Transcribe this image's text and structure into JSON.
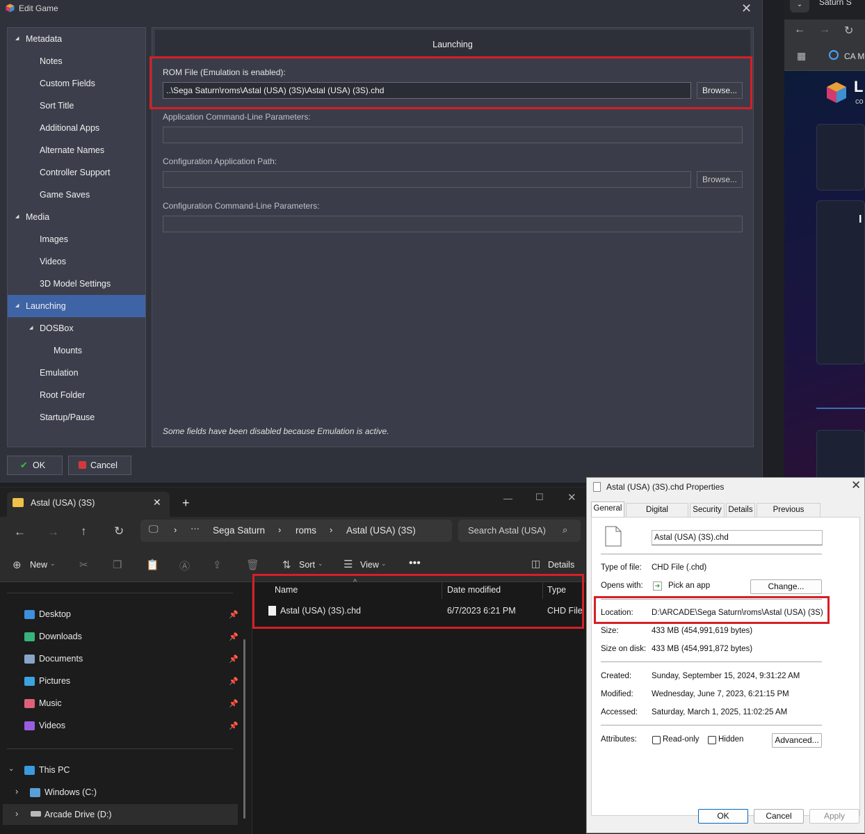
{
  "edit_game": {
    "title": "Edit Game",
    "sidebar": [
      {
        "label": "Metadata",
        "level": 0,
        "expanded": true
      },
      {
        "label": "Notes",
        "level": 1
      },
      {
        "label": "Custom Fields",
        "level": 1
      },
      {
        "label": "Sort Title",
        "level": 1
      },
      {
        "label": "Additional Apps",
        "level": 1
      },
      {
        "label": "Alternate Names",
        "level": 1
      },
      {
        "label": "Controller Support",
        "level": 1
      },
      {
        "label": "Game Saves",
        "level": 1
      },
      {
        "label": "Media",
        "level": 0,
        "expanded": true
      },
      {
        "label": "Images",
        "level": 1
      },
      {
        "label": "Videos",
        "level": 1
      },
      {
        "label": "3D Model Settings",
        "level": 1
      },
      {
        "label": "Launching",
        "level": 0,
        "expanded": true,
        "selected": true
      },
      {
        "label": "DOSBox",
        "level": 1,
        "expanded": true
      },
      {
        "label": "Mounts",
        "level": 2
      },
      {
        "label": "Emulation",
        "level": 1
      },
      {
        "label": "Root Folder",
        "level": 1
      },
      {
        "label": "Startup/Pause",
        "level": 1
      }
    ],
    "panel_title": "Launching",
    "rom_label": "ROM File (Emulation is enabled):",
    "rom_value": "..\\Sega  Saturn\\roms\\Astal (USA) (3S)\\Astal (USA) (3S).chd",
    "browse_label": "Browse...",
    "app_params_label": "Application Command-Line Parameters:",
    "app_params_value": "",
    "config_path_label": "Configuration Application Path:",
    "config_path_value": "",
    "config_params_label": "Configuration Command-Line Parameters:",
    "config_params_value": "",
    "disabled_note": "Some fields have been disabled because Emulation is active.",
    "ok_label": "OK",
    "cancel_label": "Cancel"
  },
  "browser": {
    "tab_title": "Saturn S",
    "bookmark_label": "CA M",
    "logo_text": "L",
    "logo_sub": "co"
  },
  "explorer": {
    "tab_title": "Astal (USA) (3S)",
    "breadcrumb": [
      "Sega  Saturn",
      "roms",
      "Astal (USA) (3S)"
    ],
    "search_placeholder": "Search Astal (USA)",
    "toolbar": {
      "new": "New",
      "sort": "Sort",
      "view": "View",
      "details": "Details"
    },
    "quick_access": [
      {
        "label": "Desktop",
        "color": "#3d8fe0"
      },
      {
        "label": "Downloads",
        "color": "#36b37e"
      },
      {
        "label": "Documents",
        "color": "#8aa4c8"
      },
      {
        "label": "Pictures",
        "color": "#3aa3e0"
      },
      {
        "label": "Music",
        "color": "#e0607a"
      },
      {
        "label": "Videos",
        "color": "#9a5de0"
      }
    ],
    "this_pc": "This PC",
    "drives": [
      "Windows (C:)",
      "Arcade Drive (D:)"
    ],
    "columns": [
      "Name",
      "Date modified",
      "Type"
    ],
    "files": [
      {
        "name": "Astal (USA) (3S).chd",
        "modified": "6/7/2023 6:21 PM",
        "type": "CHD File"
      }
    ]
  },
  "properties": {
    "title": "Astal (USA) (3S).chd Properties",
    "tabs": [
      "General",
      "Digital Signatures",
      "Security",
      "Details",
      "Previous Versions"
    ],
    "filename": "Astal (USA) (3S).chd",
    "type_label": "Type of file:",
    "type_value": "CHD File (.chd)",
    "opens_label": "Opens with:",
    "opens_value": "Pick an app",
    "change_label": "Change...",
    "location_label": "Location:",
    "location_value": "D:\\ARCADE\\Sega  Saturn\\roms\\Astal (USA) (3S)",
    "size_label": "Size:",
    "size_value": "433 MB (454,991,619 bytes)",
    "size_disk_label": "Size on disk:",
    "size_disk_value": "433 MB (454,991,872 bytes)",
    "created_label": "Created:",
    "created_value": "Sunday, September 15, 2024, 9:31:22 AM",
    "modified_label": "Modified:",
    "modified_value": "Wednesday, June 7, 2023, 6:21:15 PM",
    "accessed_label": "Accessed:",
    "accessed_value": "Saturday, March 1, 2025, 11:02:25 AM",
    "attributes_label": "Attributes:",
    "readonly_label": "Read-only",
    "hidden_label": "Hidden",
    "advanced_label": "Advanced...",
    "ok_label": "OK",
    "cancel_label": "Cancel",
    "apply_label": "Apply"
  }
}
